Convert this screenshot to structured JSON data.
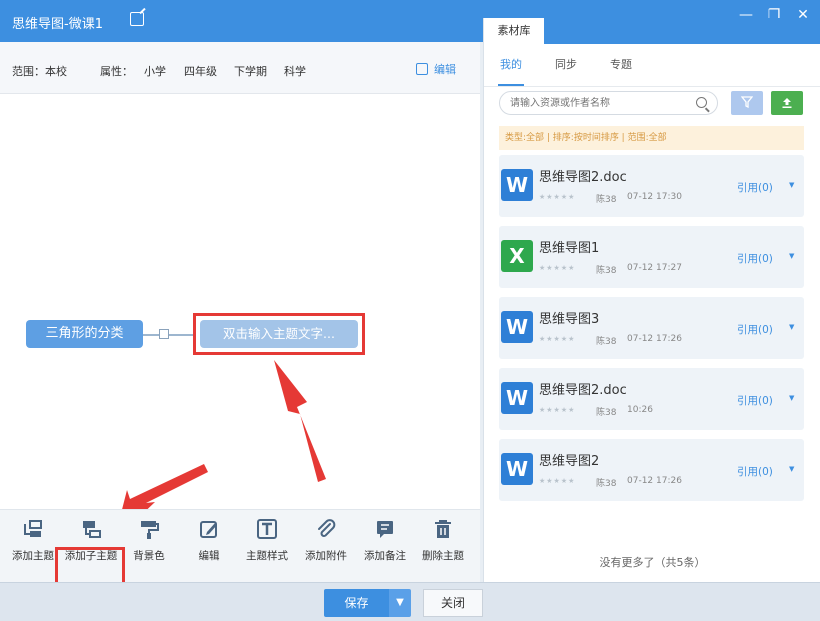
{
  "window": {
    "title": "思维导图-微课1",
    "minimize": "—",
    "restore": "❐",
    "close": "✕"
  },
  "filter": {
    "scope": "范围：本校",
    "attr_label": "属性：",
    "grade_level": "小学",
    "grade": "四年级",
    "term": "下学期",
    "subject": "科学",
    "edit": "编辑"
  },
  "mindmap": {
    "root": "三角形的分类",
    "child": "双击输入主题文字..."
  },
  "toolbar": [
    {
      "label": "添加主题",
      "icon": "add-topic-icon"
    },
    {
      "label": "添加子主题",
      "icon": "add-subtopic-icon"
    },
    {
      "label": "背景色",
      "icon": "paint-roller-icon"
    },
    {
      "label": "编辑",
      "icon": "edit-icon"
    },
    {
      "label": "主题样式",
      "icon": "text-style-icon"
    },
    {
      "label": "添加附件",
      "icon": "paperclip-icon"
    },
    {
      "label": "添加备注",
      "icon": "note-icon"
    },
    {
      "label": "删除主题",
      "icon": "trash-icon"
    }
  ],
  "footer": {
    "save": "保存",
    "close": "关闭"
  },
  "library": {
    "tab": "素材库",
    "subtabs": [
      "我的",
      "同步",
      "专题"
    ],
    "search_placeholder": "请输入资源或作者名称",
    "notice": "类型:全部 | 排序:按时间排序 | 范围:全部",
    "files": [
      {
        "type": "word",
        "name": "思维导图2.doc",
        "author": "陈38",
        "time": "07-12 17:30",
        "cite": "引用(0)"
      },
      {
        "type": "excel",
        "name": "思维导图1",
        "author": "陈38",
        "time": "07-12 17:27",
        "cite": "引用(0)"
      },
      {
        "type": "word",
        "name": "思维导图3",
        "author": "陈38",
        "time": "07-12 17:26",
        "cite": "引用(0)"
      },
      {
        "type": "word",
        "name": "思维导图2.doc",
        "author": "陈38",
        "time": "10:26",
        "cite": "引用(0)"
      },
      {
        "type": "word",
        "name": "思维导图2",
        "author": "陈38",
        "time": "07-12 17:26",
        "cite": "引用(0)"
      }
    ],
    "no_more": "没有更多了（共5条）"
  },
  "colors": {
    "accent": "#3d8fe0",
    "word": "#2e7fd6",
    "excel": "#2ea84d",
    "highlight": "#e53935"
  }
}
